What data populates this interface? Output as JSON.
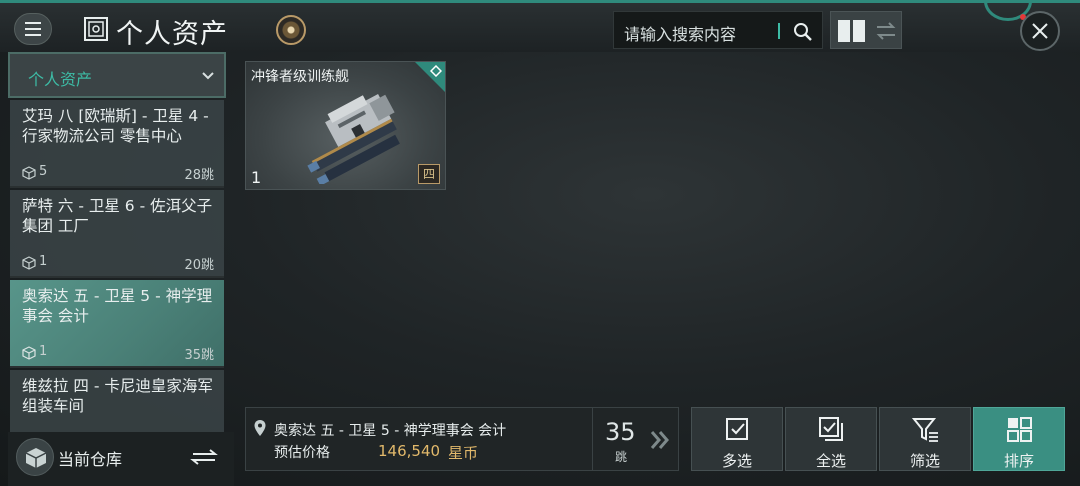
{
  "header": {
    "title": "个人资产",
    "search_placeholder": "请输入搜索内容"
  },
  "sidebar": {
    "dropdown_label": "个人资产",
    "locations": [
      {
        "name": "艾玛 八 [欧瑞斯] - 卫星 4 - 行家物流公司 零售中心",
        "count": "5",
        "jumps": "28跳",
        "active": false
      },
      {
        "name": "萨特 六 - 卫星 6 - 佐洱父子集团 工厂",
        "count": "1",
        "jumps": "20跳",
        "active": false
      },
      {
        "name": "奥索达 五 - 卫星 5 - 神学理事会 会计",
        "count": "1",
        "jumps": "35跳",
        "active": true
      },
      {
        "name": "维兹拉 四 - 卡尼迪皇家海军 组装车间",
        "count": "",
        "jumps": "",
        "active": false
      }
    ],
    "warehouse_label": "当前仓库"
  },
  "items": [
    {
      "name": "冲锋者级训练舰",
      "quantity": "1",
      "tech_badge": "四"
    }
  ],
  "bottom": {
    "location": "奥索达 五 - 卫星 5 - 神学理事会 会计",
    "price_label": "预估价格",
    "price_value": "146,540",
    "currency": "星币",
    "jumps_value": "35",
    "jumps_unit": "跳",
    "actions": [
      {
        "label": "多选",
        "icon": "checkbox-icon"
      },
      {
        "label": "全选",
        "icon": "select-all-icon"
      },
      {
        "label": "筛选",
        "icon": "filter-icon"
      },
      {
        "label": "排序",
        "icon": "grid-icon"
      }
    ]
  },
  "colors": {
    "accent": "#3dbba5",
    "active_item": "#4a8077",
    "price": "#e2b96b",
    "notification": "#e53939"
  }
}
